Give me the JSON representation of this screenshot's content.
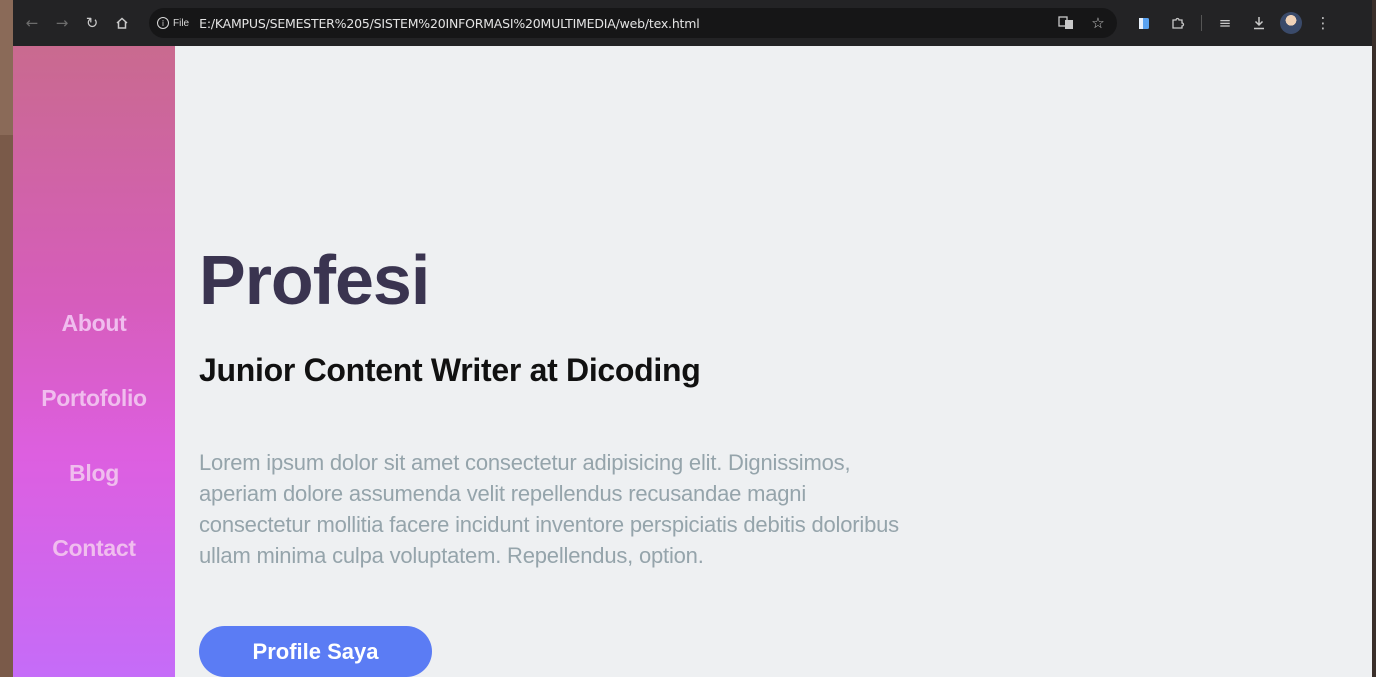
{
  "browser": {
    "url": "E:/KAMPUS/SEMESTER%205/SISTEM%20INFORMASI%20MULTIMEDIA/web/tex.html",
    "site_info_label": "File",
    "icons": {
      "back": "back-arrow-icon",
      "forward": "forward-arrow-icon",
      "reload": "reload-icon",
      "home": "home-icon",
      "translate": "translate-icon",
      "bookmark": "star-icon",
      "extension_app": "extension-app-icon",
      "extensions": "puzzle-icon",
      "reading_list": "reading-list-icon",
      "download": "download-icon",
      "profile": "profile-avatar",
      "menu": "kebab-menu-icon"
    }
  },
  "sidebar": {
    "items": [
      {
        "label": "About"
      },
      {
        "label": "Portofolio"
      },
      {
        "label": "Blog"
      },
      {
        "label": "Contact"
      }
    ]
  },
  "main": {
    "title": "Profesi",
    "subtitle": "Junior Content Writer at Dicoding",
    "description": "Lorem ipsum dolor sit amet consectetur adipisicing elit. Dignissimos, aperiam dolore assumenda velit repellendus recusandae magni consectetur mollitia facere incidunt inventore perspiciatis debitis doloribus ullam minima culpa voluptatem. Repellendus, option.",
    "cta_label": "Profile Saya"
  },
  "colors": {
    "sidebar_gradient": [
      "#c96a8f",
      "#d65dbb",
      "#dd5fe0",
      "#c56cf8"
    ],
    "nav_text": "#f0bdee",
    "title_text": "#3a3450",
    "description_text": "#95a4ab",
    "cta_background": "#5b7cf4",
    "page_background": "#eef0f2"
  }
}
